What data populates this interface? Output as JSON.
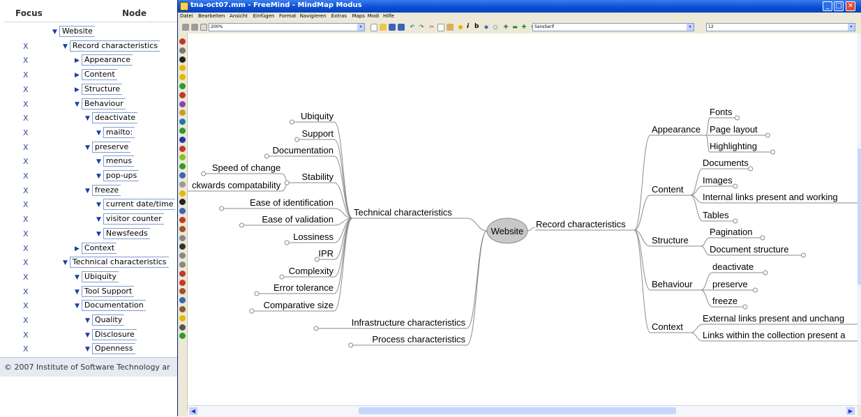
{
  "tree": {
    "col_focus": "Focus",
    "col_node": "Node",
    "rows": [
      {
        "x": "",
        "label": "Website",
        "level": 0,
        "arrow": "▼"
      },
      {
        "x": "X",
        "label": "Record characteristics",
        "level": 1,
        "arrow": "▼"
      },
      {
        "x": "X",
        "label": "Appearance",
        "level": 2,
        "arrow": "▶"
      },
      {
        "x": "X",
        "label": "Content",
        "level": 2,
        "arrow": "▶"
      },
      {
        "x": "X",
        "label": "Structure",
        "level": 2,
        "arrow": "▶"
      },
      {
        "x": "X",
        "label": "Behaviour",
        "level": 2,
        "arrow": "▼"
      },
      {
        "x": "X",
        "label": "deactivate",
        "level": 3,
        "arrow": "▼"
      },
      {
        "x": "X",
        "label": "mailto:",
        "level": 4,
        "arrow": "▼"
      },
      {
        "x": "X",
        "label": "preserve",
        "level": 3,
        "arrow": "▼"
      },
      {
        "x": "X",
        "label": "menus",
        "level": 4,
        "arrow": "▼"
      },
      {
        "x": "X",
        "label": "pop-ups",
        "level": 4,
        "arrow": "▼"
      },
      {
        "x": "X",
        "label": "freeze",
        "level": 3,
        "arrow": "▼"
      },
      {
        "x": "X",
        "label": "current date/time",
        "level": 4,
        "arrow": "▼"
      },
      {
        "x": "X",
        "label": "visitor counter",
        "level": 4,
        "arrow": "▼"
      },
      {
        "x": "X",
        "label": "Newsfeeds",
        "level": 4,
        "arrow": "▼"
      },
      {
        "x": "X",
        "label": "Context",
        "level": 2,
        "arrow": "▶"
      },
      {
        "x": "X",
        "label": "Technical characteristics",
        "level": 1,
        "arrow": "▼"
      },
      {
        "x": "X",
        "label": "Ubiquity",
        "level": 2,
        "arrow": "▼"
      },
      {
        "x": "X",
        "label": "Tool Support",
        "level": 2,
        "arrow": "▼"
      },
      {
        "x": "X",
        "label": "Documentation",
        "level": 2,
        "arrow": "▼"
      },
      {
        "x": "X",
        "label": "Quality",
        "level": 3,
        "arrow": "▼"
      },
      {
        "x": "X",
        "label": "Disclosure",
        "level": 3,
        "arrow": "▼"
      },
      {
        "x": "X",
        "label": "Openness",
        "level": 3,
        "arrow": "▼"
      }
    ],
    "footer": "© 2007 Institute of Software Technology ar"
  },
  "window": {
    "title": "tna-oct07.mm - FreeMind - MindMap Modus",
    "menus": [
      "Datei",
      "Bearbeiten",
      "Ansicht",
      "Einfügen",
      "Format",
      "Navigieren",
      "Extras",
      "Maps",
      "Modi",
      "Hilfe"
    ],
    "zoom": "200%",
    "font_name": "SansSerif",
    "font_size": "12"
  },
  "mindmap": {
    "root": "Website",
    "record": "Record characteristics",
    "technical": "Technical characteristics",
    "infrastructure": "Infrastructure characteristics",
    "process": "Process characteristics",
    "tech_children": [
      "Ubiquity",
      "Support",
      "Documentation",
      "Stability",
      "Ease of identification",
      "Ease of validation",
      "Lossiness",
      "IPR",
      "Complexity",
      "Error tolerance",
      "Comparative size"
    ],
    "stability_children": [
      "Speed of change",
      "ckwards compatability"
    ],
    "appearance": "Appearance",
    "appearance_children": [
      "Fonts",
      "Page layout",
      "Highlighting"
    ],
    "content": "Content",
    "content_children": [
      "Documents",
      "Images",
      "Internal links present and working",
      "Tables"
    ],
    "structure": "Structure",
    "structure_children": [
      "Pagination",
      "Document structure"
    ],
    "behaviour": "Behaviour",
    "behaviour_children": [
      "deactivate",
      "preserve",
      "freeze"
    ],
    "context": "Context",
    "context_children": [
      "External links present and unchang",
      "Links within the collection present a"
    ]
  },
  "colors": {
    "title_blue": "#0c4fd4",
    "link_gray": "#888888",
    "root_fill": "#c8c8c8"
  }
}
